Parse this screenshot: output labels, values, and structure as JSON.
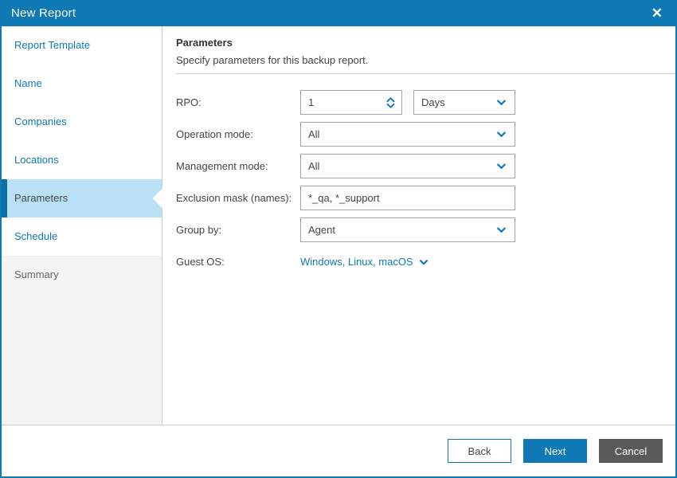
{
  "window": {
    "title": "New Report"
  },
  "icons": {
    "close_glyph": "✕"
  },
  "colors": {
    "accent_blue": "#0e79b5",
    "selected_item_bg": "#b9e0f5",
    "selected_item_accent": "#0b6fa9",
    "cancel_button_bg": "#595959",
    "divider_gray": "#cccccc"
  },
  "sidebar": {
    "items": [
      {
        "label": "Report Template",
        "state": "link"
      },
      {
        "label": "Name",
        "state": "link"
      },
      {
        "label": "Companies",
        "state": "link"
      },
      {
        "label": "Locations",
        "state": "link"
      },
      {
        "label": "Parameters",
        "state": "selected"
      },
      {
        "label": "Schedule",
        "state": "link"
      },
      {
        "label": "Summary",
        "state": "disabled"
      }
    ]
  },
  "content": {
    "heading": "Parameters",
    "subtitle": "Specify parameters for this backup report.",
    "fields": {
      "rpo": {
        "label": "RPO:",
        "value": "1",
        "unit": "Days"
      },
      "operation_mode": {
        "label": "Operation mode:",
        "value": "All"
      },
      "management_mode": {
        "label": "Management mode:",
        "value": "All"
      },
      "exclusion_mask": {
        "label": "Exclusion mask (names):",
        "value": "*_qa, *_support"
      },
      "group_by": {
        "label": "Group by:",
        "value": "Agent"
      },
      "guest_os": {
        "label": "Guest OS:",
        "value": "Windows, Linux, macOS"
      }
    }
  },
  "footer": {
    "back_label": "Back",
    "next_label": "Next",
    "cancel_label": "Cancel"
  }
}
